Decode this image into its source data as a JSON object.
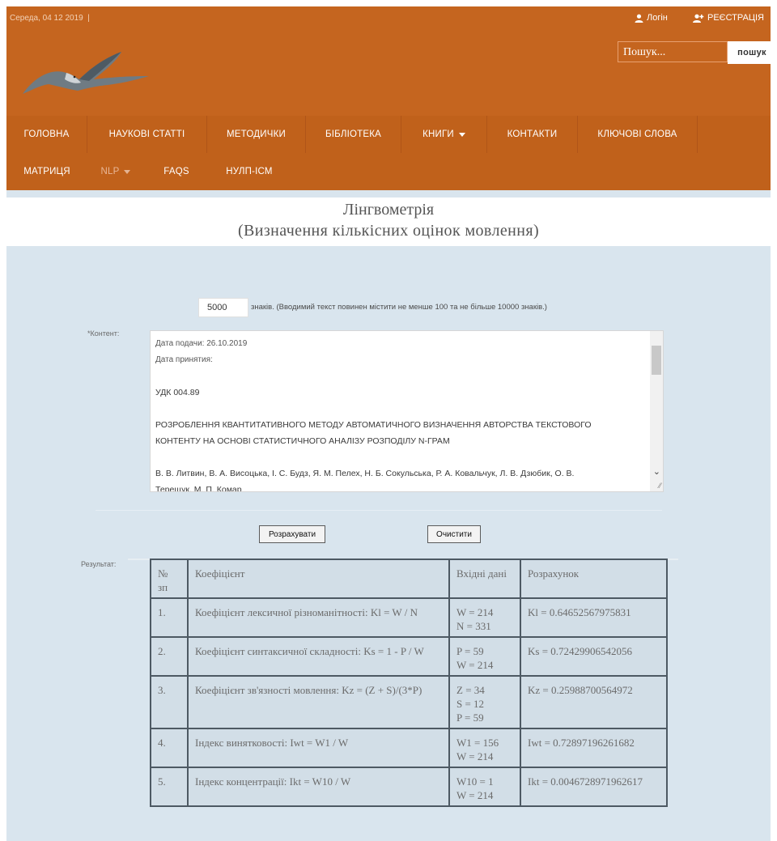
{
  "header": {
    "date": "Середа, 04 12 2019",
    "date_separator": "|",
    "login": "Логін",
    "register": "РЕЄСТРАЦІЯ",
    "search_placeholder": "Пошук...",
    "search_button": "пошук",
    "brand_color": "#c5651f"
  },
  "nav": {
    "row1": [
      "ГОЛОВНА",
      "НАУКОВІ СТАТТІ",
      "МЕТОДИЧКИ",
      "БІБЛІОТЕКА",
      "КНИГИ",
      "КОНТАКТИ",
      "КЛЮЧОВІ СЛОВА"
    ],
    "row2": [
      "МАТРИЦЯ",
      "NLP",
      "FAQS",
      "НУЛП-ІСМ"
    ]
  },
  "title": {
    "line1": "Лінгвометрія",
    "line2": "(Визначення кількісних оцінок мовлення)"
  },
  "form": {
    "char_count": "5000",
    "char_note": "знаків. (Вводимий текст повинен містити не менше 100 та не більше 10000 знаків.)",
    "content_label": "*Контент:",
    "content_lines": [
      "Дата подачи: 26.10.2019",
      "Дата принятия:",
      "",
      "УДК 004.89",
      "",
      "РОЗРОБЛЕННЯ КВАНТИТАТИВНОГО МЕТОДУ АВТОМАТИЧНОГО ВИЗНАЧЕННЯ АВТОРСТВА ТЕКСТОВОГО",
      "КОНТЕНТУ НА ОСНОВІ СТАТИСТИЧНОГО АНАЛІЗУ РОЗПОДІЛУ N-ГРАМ",
      "",
      "В. В. Литвин, В. А. Висоцька, І. С. Будз, Я. М. Пелех, Н. Б. Сокульська, Р. А. Ковальчук, Л. В. Дзюбик, О. В.",
      "Терещук, М. П. Комар"
    ],
    "calc_button": "Розрахувати",
    "clear_button": "Очистити",
    "result_label": "Результат:"
  },
  "results": {
    "headers": [
      "№ зп",
      "Коефіцієнт",
      "Вхідні дані",
      "Розрахунок"
    ],
    "rows": [
      {
        "n": "1.",
        "name": "Коефіцієнт лексичної різноманітності: Kl = W / N",
        "inputs": [
          "W = 214",
          "N = 331"
        ],
        "result": "Kl = 0.64652567975831"
      },
      {
        "n": "2.",
        "name": "Коефіцієнт синтаксичної складності: Ks = 1 - P / W",
        "inputs": [
          "P = 59",
          "W = 214"
        ],
        "result": "Ks = 0.72429906542056"
      },
      {
        "n": "3.",
        "name": "Коефіцієнт зв'язності мовлення: Kz = (Z + S)/(3*P)",
        "inputs": [
          "Z = 34",
          "S = 12",
          "P = 59"
        ],
        "result": "Kz = 0.25988700564972"
      },
      {
        "n": "4.",
        "name": "Індекс винятковості: Iwt = W1 / W",
        "inputs": [
          "W1 = 156",
          "W = 214"
        ],
        "result": "Iwt = 0.72897196261682"
      },
      {
        "n": "5.",
        "name": "Індекс концентрації: Ikt = W10 / W",
        "inputs": [
          "W10 = 1",
          "W = 214"
        ],
        "result": "Ikt = 0.0046728971962617"
      }
    ]
  }
}
